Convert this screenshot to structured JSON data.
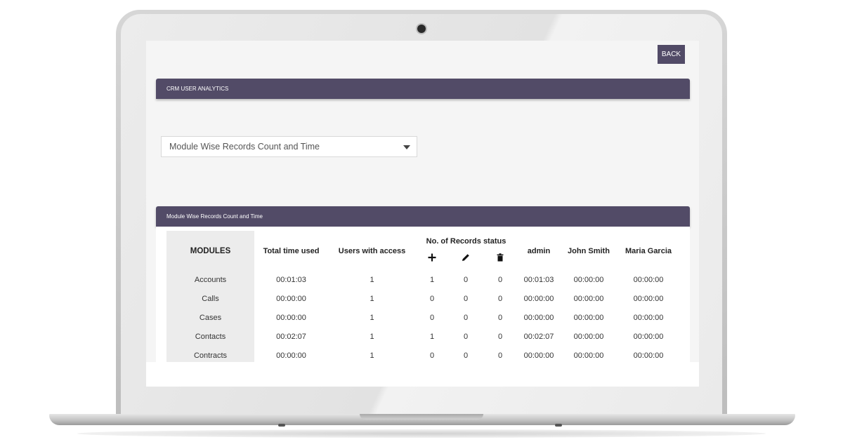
{
  "toolbar": {
    "back_label": "BACK"
  },
  "analytics_panel": {
    "title": "CRM USER ANALYTICS"
  },
  "report_select": {
    "selected": "Module Wise Records Count and Time"
  },
  "records_panel": {
    "title": "Module Wise Records Count and Time"
  },
  "table": {
    "headers": {
      "modules": "MODULES",
      "total_time": "Total time used",
      "users_access": "Users with access",
      "records_status": "No. of Records status",
      "admin": "admin",
      "john": "John Smith",
      "maria": "Maria Garcia"
    },
    "status_icons": [
      "plus-icon",
      "pencil-icon",
      "trash-icon"
    ],
    "rows": [
      {
        "module": "Accounts",
        "total_time": "00:01:03",
        "users": "1",
        "created": "1",
        "edited": "0",
        "deleted": "0",
        "admin": "00:01:03",
        "john": "00:00:00",
        "maria": "00:00:00"
      },
      {
        "module": "Calls",
        "total_time": "00:00:00",
        "users": "1",
        "created": "0",
        "edited": "0",
        "deleted": "0",
        "admin": "00:00:00",
        "john": "00:00:00",
        "maria": "00:00:00"
      },
      {
        "module": "Cases",
        "total_time": "00:00:00",
        "users": "1",
        "created": "0",
        "edited": "0",
        "deleted": "0",
        "admin": "00:00:00",
        "john": "00:00:00",
        "maria": "00:00:00"
      },
      {
        "module": "Contacts",
        "total_time": "00:02:07",
        "users": "1",
        "created": "1",
        "edited": "0",
        "deleted": "0",
        "admin": "00:02:07",
        "john": "00:00:00",
        "maria": "00:00:00"
      },
      {
        "module": "Contracts",
        "total_time": "00:00:00",
        "users": "1",
        "created": "0",
        "edited": "0",
        "deleted": "0",
        "admin": "00:00:00",
        "john": "00:00:00",
        "maria": "00:00:00"
      }
    ]
  },
  "colors": {
    "header_bg": "#524b67",
    "screen_bg": "#f5f5f5"
  }
}
